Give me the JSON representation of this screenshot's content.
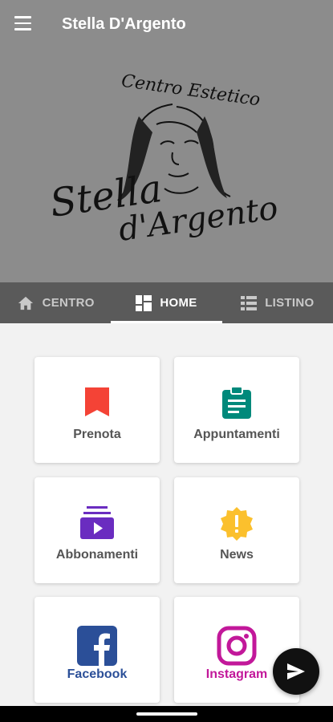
{
  "app": {
    "title": "Stella D'Argento"
  },
  "logo": {
    "top_text": "Centro Estetico",
    "name_line1": "Stella",
    "name_line2": "d'Argento"
  },
  "tabs": [
    {
      "label": "CENTRO",
      "icon": "home-icon"
    },
    {
      "label": "HOME",
      "icon": "dashboard-icon",
      "active": true
    },
    {
      "label": "LISTINO",
      "icon": "list-icon"
    }
  ],
  "cards": [
    {
      "label": "Prenota",
      "icon": "bookmark-icon",
      "color": "#f44336"
    },
    {
      "label": "Appuntamenti",
      "icon": "clipboard-icon",
      "color": "#00897b"
    },
    {
      "label": "Abbonamenti",
      "icon": "subscriptions-icon",
      "color": "#6a2cc0"
    },
    {
      "label": "News",
      "icon": "alert-badge-icon",
      "color": "#fbc02d"
    },
    {
      "label": "Facebook",
      "icon": "facebook-icon",
      "color": "#2b4f98"
    },
    {
      "label": "Instagram",
      "icon": "instagram-icon",
      "color": "#c2189a"
    }
  ]
}
